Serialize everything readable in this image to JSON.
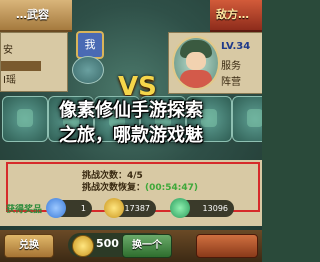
{
  "header": {
    "left_title": "…武容",
    "right_title": "敌方…"
  },
  "player": {
    "line1": "安",
    "line2": "I瑶"
  },
  "center": {
    "shield_label": "我",
    "vs_label": "VS"
  },
  "enemy": {
    "level": "LV.34",
    "name": "服务",
    "faction": "阵营"
  },
  "headline": {
    "line1": "像素修仙手游探索",
    "line2": "之旅，哪款游戏魅"
  },
  "challenge": {
    "count_label": "挑战次数：4/5",
    "recover_label": "挑战次数恢复：",
    "recover_time": "(00:54:47)"
  },
  "rewards": {
    "label": "获得奖品",
    "items": [
      {
        "icon": "blue-orb-icon",
        "value": "1",
        "color": "#3a7ad8"
      },
      {
        "icon": "gold-coin-icon",
        "value": "17387",
        "color": "#e3b53a"
      },
      {
        "icon": "green-gem-icon",
        "value": "13096",
        "color": "#3fbf6a"
      }
    ]
  },
  "actions": {
    "exchange_label": "兑换",
    "cost_value": "500",
    "oneclick_label": "换一个"
  }
}
